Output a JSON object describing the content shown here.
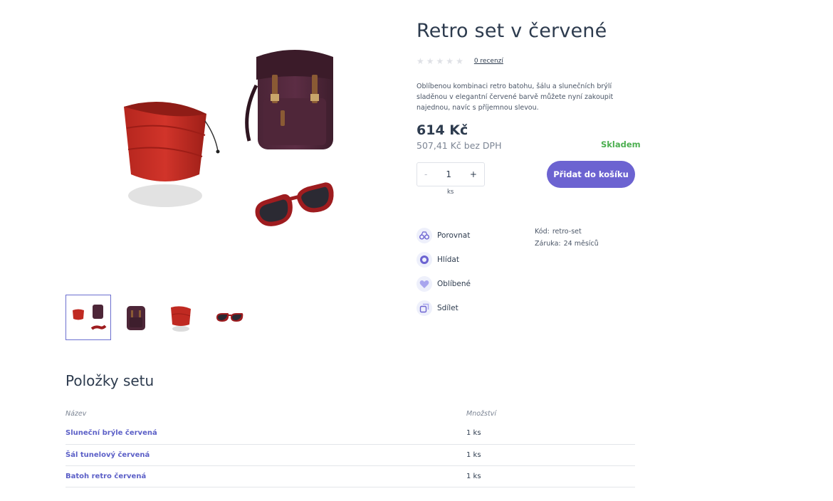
{
  "product": {
    "title": "Retro set v červené",
    "rating_stars": 0,
    "reviews_label": "0 recenzí",
    "description": "Oblíbenou kombinaci retro batohu, šálu a slunečních brýlí sladěnou v elegantní červené barvě můžete nyní zakoupit najednou, navíc s příjemnou slevou.",
    "price": "614 Kč",
    "price_without_vat": "507,41 Kč bez DPH",
    "stock_status": "Skladem",
    "quantity": {
      "value": "1",
      "minus": "-",
      "plus": "+",
      "unit": "ks"
    },
    "add_to_cart_label": "Přidat do košíku"
  },
  "gallery": {
    "main_image": "product-set-image",
    "thumbnails": [
      {
        "name": "thumb-set",
        "active": true
      },
      {
        "name": "thumb-backpack",
        "active": false
      },
      {
        "name": "thumb-scarf",
        "active": false
      },
      {
        "name": "thumb-sunglasses",
        "active": false
      }
    ]
  },
  "actions": [
    {
      "label": "Porovnat",
      "icon": "compare-icon"
    },
    {
      "label": "Hlídat",
      "icon": "watch-icon"
    },
    {
      "label": "Oblíbené",
      "icon": "heart-icon"
    },
    {
      "label": "Sdílet",
      "icon": "share-icon"
    }
  ],
  "meta": {
    "code_label": "Kód:",
    "code_value": "retro-set",
    "warranty_label": "Záruka:",
    "warranty_value": "24 měsíců"
  },
  "set_items": {
    "title": "Položky setu",
    "headers": {
      "name": "Název",
      "quantity": "Množství"
    },
    "rows": [
      {
        "name": "Sluneční brýle červená",
        "quantity": "1 ks"
      },
      {
        "name": "Šál tunelový červená",
        "quantity": "1 ks"
      },
      {
        "name": "Batoh retro červená",
        "quantity": "1 ks"
      }
    ]
  },
  "colors": {
    "accent": "#6c63d1",
    "link": "#5b5fc7",
    "stock": "#4caf50",
    "text": "#2d3b4e"
  }
}
